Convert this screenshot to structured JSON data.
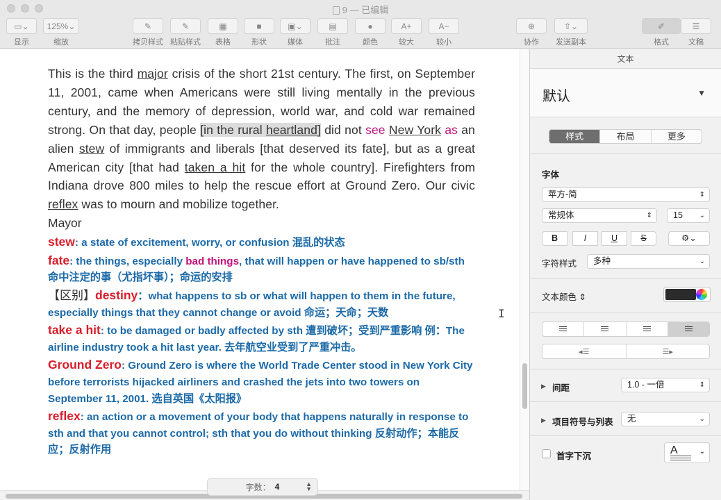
{
  "window": {
    "title": "9 — 已编辑"
  },
  "toolbar": {
    "items": [
      {
        "label": "显示",
        "glyph": "▭⌄"
      },
      {
        "label": "缩放",
        "glyph": "125%⌄"
      },
      {
        "label": "拷贝样式",
        "glyph": "✎"
      },
      {
        "label": "粘贴样式",
        "glyph": "✎"
      },
      {
        "label": "表格",
        "glyph": "▦"
      },
      {
        "label": "形状",
        "glyph": "■"
      },
      {
        "label": "媒体",
        "glyph": "▣⌄"
      },
      {
        "label": "批注",
        "glyph": "▤"
      },
      {
        "label": "颜色",
        "glyph": "●"
      },
      {
        "label": "较大",
        "glyph": "A+"
      },
      {
        "label": "较小",
        "glyph": "A−"
      },
      {
        "label": "协作",
        "glyph": "⊕"
      },
      {
        "label": "发送副本",
        "glyph": "⇧⌄"
      },
      {
        "label": "格式",
        "glyph": "✐"
      },
      {
        "label": "文稿",
        "glyph": "☰"
      }
    ]
  },
  "document": {
    "p1": {
      "t1": "This is the third ",
      "major": "major",
      "t2": " crisis of the short 21st century. The first, on September 11, 2001, came when Americans were still living mentally in the previous century, and the memory of depression, world war, and cold war remained strong. On that day, people ",
      "rural1": "[in the rural ",
      "rural2": "heartland",
      "rural3": "]",
      "t3": " did not ",
      "see": "see",
      "t4": " ",
      "newyork": "New York",
      "t5": " ",
      "as": "as",
      "t6": " an alien ",
      "stew": "stew",
      "t7": " of immigrants and liberals [that deserved its fate], but as a great American city [that had ",
      "takenahit": "taken a hit",
      "t8": " for the whole country]. Firefighters from Indiana drove 800 miles to help the rescue effort at Ground Zero. Our civic ",
      "reflex": "reflex",
      "t9": " was to mourn and mobilize together."
    },
    "mayor": "Mayor",
    "defs": {
      "stew_w": "stew",
      "stew_d": ": a state of excitement, worry, or confusion 混乱的状态",
      "fate_w": "fate",
      "fate_d1": ": the things, especially ",
      "fate_m": "bad things",
      "fate_d2": ", that will happen or have happened to sb/sth 命中注定的事（尤指坏事）；命运的安排",
      "destiny_k": "【区别】",
      "destiny_w": "destiny",
      "destiny_d": "：what happens to sb or what will happen to them in the future, especially things that they cannot change or avoid 命运；天命；天数",
      "hit_w": "take a hit",
      "hit_d": ": to be damaged or badly affected by sth 遭到破坏；受到严重影响 例：The airline industry took a hit last year. 去年航空业受到了严重冲击。",
      "gz_w": "Ground Zero",
      "gz_d": ": Ground Zero is where the World Trade Center stood in New York City before terrorists hijacked airliners and crashed the jets into two towers on September 11, 2001. 选自英国《太阳报》",
      "reflex_w": "reflex",
      "reflex_d": ": an action or a movement of your body that happens naturally in response to sth and that you cannot control; sth that you do without thinking 反射动作；本能反应；反射作用"
    }
  },
  "wordcount": {
    "label": "字数：",
    "value": "4"
  },
  "sidebar": {
    "header": "文本",
    "style_name": "默认",
    "tabs": [
      "样式",
      "布局",
      "更多"
    ],
    "font_label": "字体",
    "font_family": "苹方-简",
    "font_style": "常规体",
    "font_size": "15",
    "bold": "B",
    "italic": "I",
    "underline": "U",
    "strike": "S",
    "char_style_label": "字符样式",
    "char_style_value": "多种",
    "text_color_label": "文本颜色",
    "spacing_label": "间距",
    "spacing_value": "1.0 - 一倍",
    "bullets_label": "项目符号与列表",
    "bullets_value": "无",
    "dropcap_label": "首字下沉",
    "text_color": "#2b2b2b"
  }
}
